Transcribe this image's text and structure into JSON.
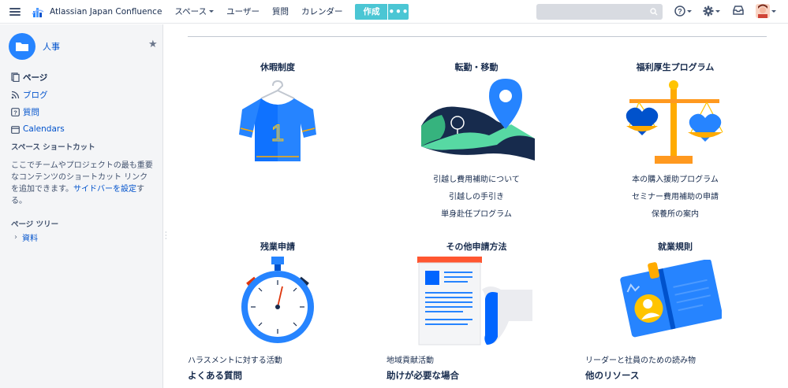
{
  "header": {
    "app_title": "Atlassian Japan Confluence",
    "nav": [
      "スペース",
      "ユーザー",
      "質問",
      "カレンダー"
    ],
    "create_label": "作成",
    "more_label": "•••",
    "search_placeholder": ""
  },
  "sidebar": {
    "space_name": "人事",
    "nav_items": [
      {
        "label": "ページ",
        "icon": "page-icon"
      },
      {
        "label": "ブログ",
        "icon": "blog-icon"
      },
      {
        "label": "質問",
        "icon": "question-icon"
      },
      {
        "label": "Calendars",
        "icon": "calendar-icon"
      }
    ],
    "shortcuts_heading": "スペース ショートカット",
    "shortcuts_text_before": "ここでチームやプロジェクトの最も重要なコンテンツのショートカット リンクを追加できます。",
    "shortcuts_link": "サイドバーを設定",
    "shortcuts_text_after": "する。",
    "page_tree_heading": "ページ ツリー",
    "tree_items": [
      "資料"
    ]
  },
  "cards": [
    {
      "title": "休暇制度",
      "links": []
    },
    {
      "title": "転勤・移動",
      "links": [
        "引越し費用補助について",
        "引越しの手引き",
        "単身赴任プログラム"
      ]
    },
    {
      "title": "福利厚生プログラム",
      "links": [
        "本の購入援助プログラム",
        "セミナー費用補助の申請",
        "保養所の案内"
      ]
    },
    {
      "title": "残業申請",
      "links": []
    },
    {
      "title": "その他申請方法",
      "links": []
    },
    {
      "title": "就業規則",
      "links": []
    }
  ],
  "bottom": {
    "col1_text": "ハラスメントに対する活動",
    "col2_text": "地域貢献活動",
    "col3_text": "リーダーと社員のための読み物",
    "col1_head": "よくある質問",
    "col2_head": "助けが必要な場合",
    "col3_head": "他のリソース"
  },
  "colors": {
    "accent": "#4bc6d4",
    "link": "#0052cc",
    "brand_blue": "#2684ff"
  }
}
